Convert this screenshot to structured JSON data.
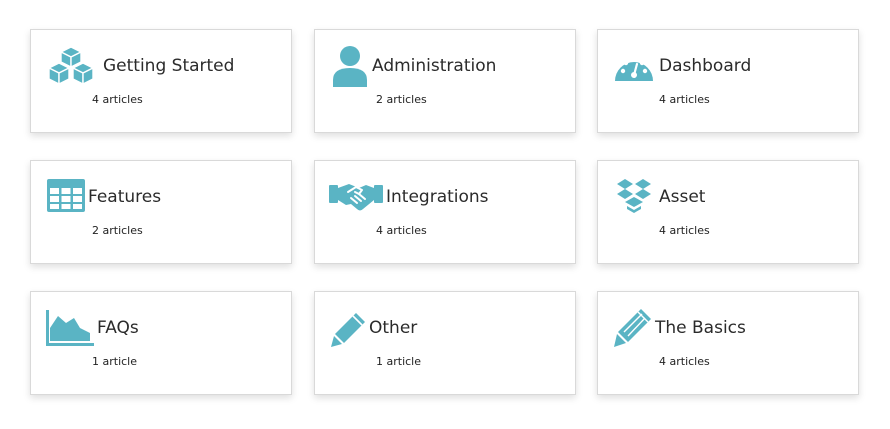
{
  "colors": {
    "accent": "#5ab4c4",
    "border": "#d9d9d9",
    "text": "#2b2b2b"
  },
  "categories": [
    {
      "title": "Getting Started",
      "count": "4 articles",
      "icon": "cubes-icon"
    },
    {
      "title": "Administration",
      "count": "2 articles",
      "icon": "user-icon"
    },
    {
      "title": "Dashboard",
      "count": "4 articles",
      "icon": "dashboard-gauge-icon"
    },
    {
      "title": "Features",
      "count": "2 articles",
      "icon": "table-grid-icon"
    },
    {
      "title": "Integrations",
      "count": "4 articles",
      "icon": "handshake-icon"
    },
    {
      "title": "Asset",
      "count": "4 articles",
      "icon": "dropbox-icon"
    },
    {
      "title": "FAQs",
      "count": "1 article",
      "icon": "area-chart-icon"
    },
    {
      "title": "Other",
      "count": "1 article",
      "icon": "pencil-icon"
    },
    {
      "title": "The Basics",
      "count": "4 articles",
      "icon": "pencil-icon"
    }
  ]
}
